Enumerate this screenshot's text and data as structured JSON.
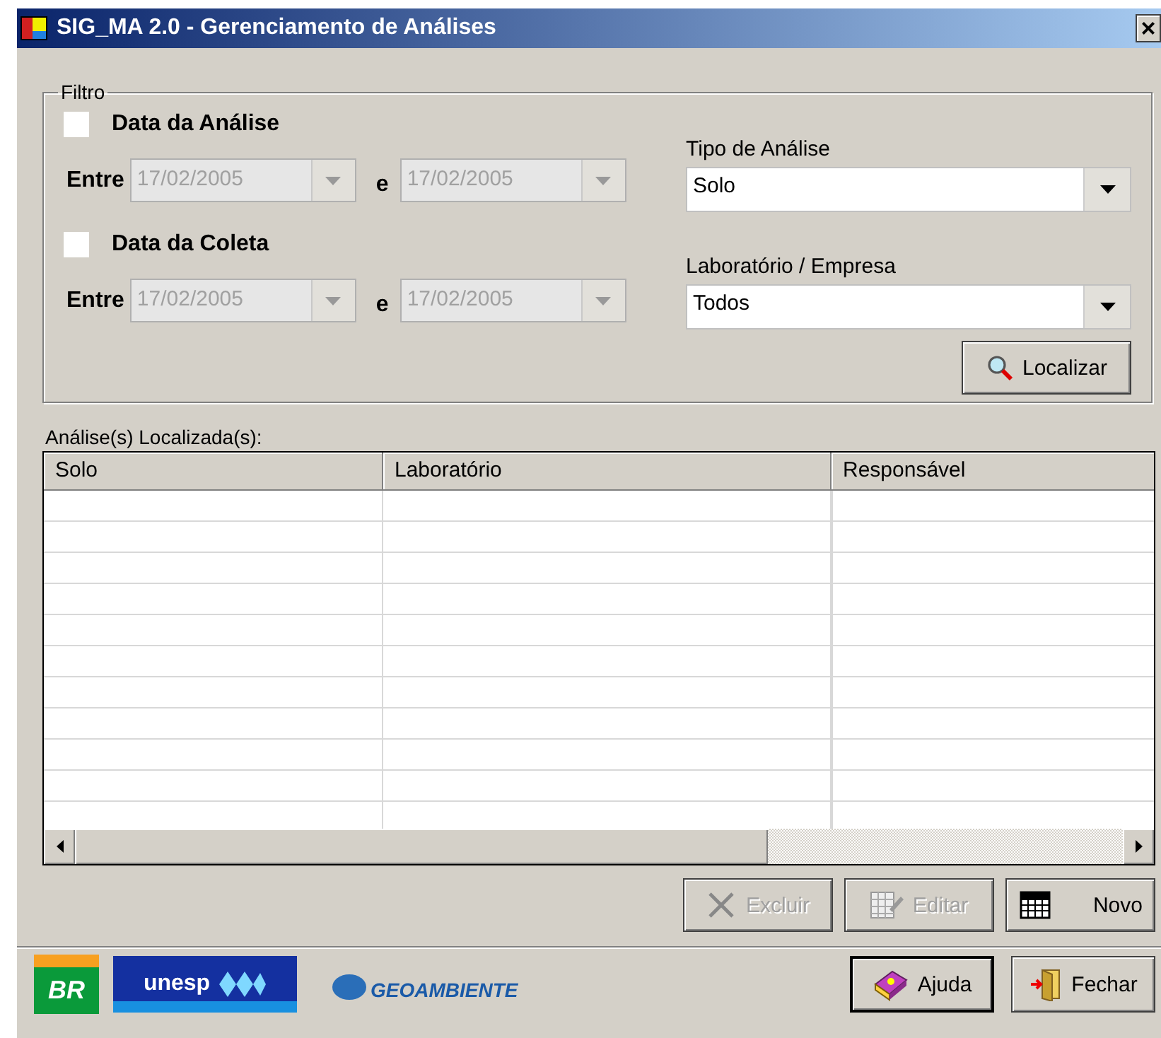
{
  "window": {
    "title": "SIG_MA 2.0 - Gerenciamento de Análises",
    "close": "×"
  },
  "filter": {
    "legend": "Filtro",
    "date_groups": [
      {
        "label": "Data da Análise",
        "checked": false,
        "between": "Entre",
        "from": "17/02/2005",
        "and": "e",
        "to": "17/02/2005",
        "disabled": true
      },
      {
        "label": "Data da Coleta",
        "checked": false,
        "between": "Entre",
        "from": "17/02/2005",
        "and": "e",
        "to": "17/02/2005",
        "disabled": true
      }
    ],
    "combos": [
      {
        "label": "Tipo de Análise",
        "value": "Solo"
      },
      {
        "label": "Laboratório / Empresa",
        "value": "Todos"
      }
    ],
    "search_button": {
      "label": "Localizar"
    }
  },
  "results": {
    "label": "Análise(s)  Localizada(s):",
    "columns": [
      "Solo",
      "Laboratório",
      "Responsável"
    ]
  },
  "actions": [
    {
      "label": "Excluir",
      "kind": "delete",
      "disabled": true
    },
    {
      "label": "Editar",
      "kind": "edit",
      "disabled": true
    },
    {
      "label": "Novo",
      "kind": "new",
      "disabled": false
    }
  ],
  "logos": [
    {
      "kind": "br",
      "text": "BR"
    },
    {
      "kind": "unesp",
      "text": "unesp"
    },
    {
      "kind": "geo",
      "text": "GEOAMBIENTE"
    }
  ],
  "footer_buttons": [
    {
      "label": "Ajuda",
      "kind": "help",
      "default": true
    },
    {
      "label": "Fechar",
      "kind": "close",
      "default": false
    }
  ]
}
